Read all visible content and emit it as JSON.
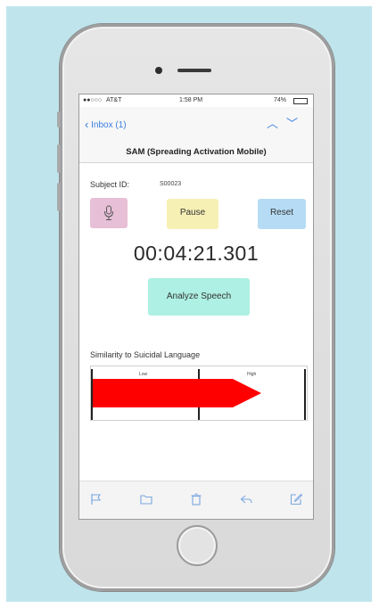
{
  "status_bar": {
    "carrier": "AT&T",
    "time": "1:58 PM",
    "battery": "74%"
  },
  "nav": {
    "back_label": "Inbox (1)",
    "up_icon": "chevron-up-icon",
    "down_icon": "chevron-down-icon"
  },
  "app": {
    "title": "SAM (Spreading Activation Mobile)"
  },
  "subject": {
    "label": "Subject ID:",
    "value": "S00023"
  },
  "controls": {
    "mic_icon": "microphone-icon",
    "pause_label": "Pause",
    "reset_label": "Reset"
  },
  "timer": {
    "value": "00:04:21.301"
  },
  "analyze": {
    "label": "Analyze Speech"
  },
  "similarity": {
    "label": "Similarity to Suicidal Language",
    "low_label": "Low",
    "high_label": "High",
    "level_fraction": 0.8
  },
  "toolbar": {
    "icons": [
      "flag-icon",
      "folder-icon",
      "trash-icon",
      "reply-icon",
      "compose-icon"
    ]
  },
  "colors": {
    "background": "#bfe4ec",
    "mic_button": "#e7bfd6",
    "pause_button": "#f6f0b4",
    "reset_button": "#b6dcf5",
    "analyze_button": "#aef0e4",
    "gauge_fill": "#ff0000",
    "ios_blue": "#3b7fe0"
  }
}
